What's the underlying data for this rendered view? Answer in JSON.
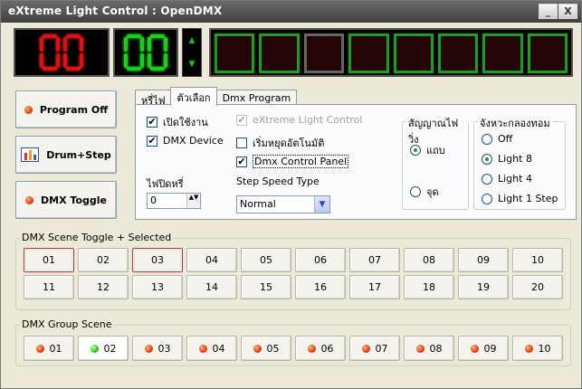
{
  "window": {
    "title": "eXtreme Light Control  :  OpenDMX",
    "minimize": "_",
    "close": "X"
  },
  "displays": {
    "red_digits": [
      "0",
      "0"
    ],
    "green_digits": [
      "0",
      "0"
    ],
    "spin_up": "▲",
    "spin_down": "▼",
    "channels": [
      "on",
      "on",
      "off",
      "on",
      "on",
      "on",
      "on",
      "on"
    ]
  },
  "left_buttons": {
    "program_off": "Program Off",
    "drum_step": "Drum+Step",
    "dmx_toggle": "DMX Toggle"
  },
  "tabs": [
    "หรี่ไฟ",
    "ตัวเลือก",
    "Dmx Program"
  ],
  "options": {
    "enable": {
      "label": "เปิดใช้งาน",
      "checked": "✔"
    },
    "dmx_device": {
      "label": "DMX Device",
      "checked": "✔"
    },
    "extreme_light_control": {
      "label": "eXtreme Light Control",
      "checked": "✔"
    },
    "auto_stop": {
      "label": "เริ่มหยุดอัตโนมัติ"
    },
    "dmx_control_panel": {
      "label": "Dmx Control Panel",
      "checked": "✔"
    },
    "dim_label": "ไฟปิดหรี่",
    "dim_value": "0",
    "spin_arrows": "▲▼",
    "step_speed_label": "Step Speed Type",
    "step_speed_value": "Normal",
    "dropdown_arrow": "▼"
  },
  "signal_group": {
    "title": "สัญญาณไฟวิ่ง",
    "options": [
      "แถบ",
      "จุด"
    ],
    "selected": "แถบ"
  },
  "rhythm_group": {
    "title": "จังหวะกลองทอม",
    "options": [
      "Off",
      "Light 8",
      "Light 4",
      "Light 1 Step"
    ],
    "selected": "Light 8"
  },
  "scene_toggle": {
    "title": "DMX Scene Toggle + Selected",
    "row1": [
      "01",
      "02",
      "03",
      "04",
      "05",
      "06",
      "07",
      "08",
      "09",
      "10"
    ],
    "row2": [
      "11",
      "12",
      "13",
      "14",
      "15",
      "16",
      "17",
      "18",
      "19",
      "20"
    ],
    "selected": [
      "01",
      "03"
    ]
  },
  "group_scene": {
    "title": "DMX Group Scene",
    "items": [
      "01",
      "02",
      "03",
      "04",
      "05",
      "06",
      "07",
      "08",
      "09",
      "10"
    ],
    "active": "02"
  },
  "colors": {
    "accent_red": "#e01010",
    "accent_green": "#18d018",
    "selected_border": "#c83030"
  }
}
